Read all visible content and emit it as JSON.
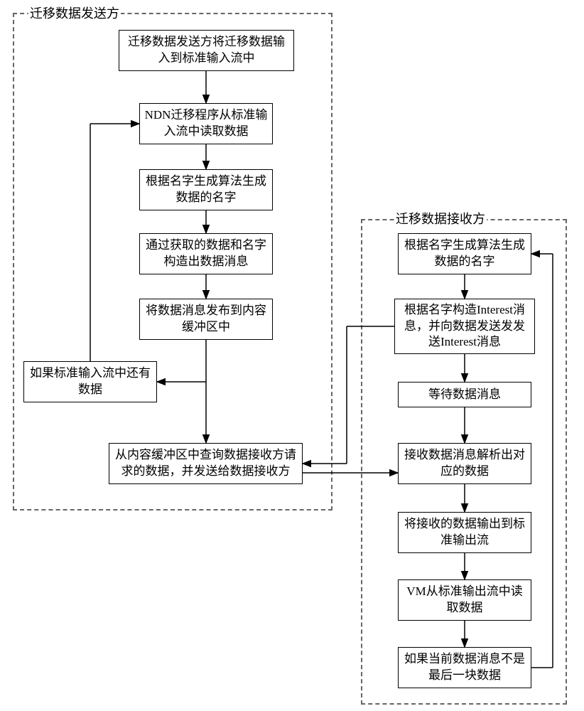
{
  "sender": {
    "title": "迁移数据发送方",
    "steps": {
      "b1": "迁移数据发送方将迁移数据输入到标准输入流中",
      "b2": "NDN迁移程序从标准输入流中读取数据",
      "b3": "根据名字生成算法生成数据的名字",
      "b4": "通过获取的数据和名字构造出数据消息",
      "b5": "将数据消息发布到内容缓冲区中",
      "b6": "如果标准输入流中还有数据",
      "b7": "从内容缓冲区中查询数据接收方请求的数据，并发送给数据接收方"
    }
  },
  "receiver": {
    "title": "迁移数据接收方",
    "steps": {
      "r1": "根据名字生成算法生成数据的名字",
      "r2": "根据名字构造Interest消息，并向数据发送发发送Interest消息",
      "r3": "等待数据消息",
      "r4": "接收数据消息解析出对应的数据",
      "r5": "将接收的数据输出到标准输出流",
      "r6": "VM从标准输出流中读取数据",
      "r7": "如果当前数据消息不是最后一块数据"
    }
  },
  "chart_data": {
    "type": "flowchart",
    "swimlanes": [
      {
        "id": "sender",
        "title": "迁移数据发送方"
      },
      {
        "id": "receiver",
        "title": "迁移数据接收方"
      }
    ],
    "nodes": [
      {
        "id": "b1",
        "lane": "sender",
        "text": "迁移数据发送方将迁移数据输入到标准输入流中"
      },
      {
        "id": "b2",
        "lane": "sender",
        "text": "NDN迁移程序从标准输入流中读取数据"
      },
      {
        "id": "b3",
        "lane": "sender",
        "text": "根据名字生成算法生成数据的名字"
      },
      {
        "id": "b4",
        "lane": "sender",
        "text": "通过获取的数据和名字构造出数据消息"
      },
      {
        "id": "b5",
        "lane": "sender",
        "text": "将数据消息发布到内容缓冲区中"
      },
      {
        "id": "b6",
        "lane": "sender",
        "text": "如果标准输入流中还有数据"
      },
      {
        "id": "b7",
        "lane": "sender",
        "text": "从内容缓冲区中查询数据接收方请求的数据，并发送给数据接收方"
      },
      {
        "id": "r1",
        "lane": "receiver",
        "text": "根据名字生成算法生成数据的名字"
      },
      {
        "id": "r2",
        "lane": "receiver",
        "text": "根据名字构造Interest消息，并向数据发送发发送Interest消息"
      },
      {
        "id": "r3",
        "lane": "receiver",
        "text": "等待数据消息"
      },
      {
        "id": "r4",
        "lane": "receiver",
        "text": "接收数据消息解析出对应的数据"
      },
      {
        "id": "r5",
        "lane": "receiver",
        "text": "将接收的数据输出到标准输出流"
      },
      {
        "id": "r6",
        "lane": "receiver",
        "text": "VM从标准输出流中读取数据"
      },
      {
        "id": "r7",
        "lane": "receiver",
        "text": "如果当前数据消息不是最后一块数据"
      }
    ],
    "edges": [
      {
        "from": "b1",
        "to": "b2"
      },
      {
        "from": "b2",
        "to": "b3"
      },
      {
        "from": "b3",
        "to": "b4"
      },
      {
        "from": "b4",
        "to": "b5"
      },
      {
        "from": "b5",
        "to": "b6",
        "condition": "loop"
      },
      {
        "from": "b6",
        "to": "b2"
      },
      {
        "from": "b5",
        "to": "b7"
      },
      {
        "from": "r1",
        "to": "r2"
      },
      {
        "from": "r2",
        "to": "r3"
      },
      {
        "from": "r3",
        "to": "r4"
      },
      {
        "from": "r4",
        "to": "r5"
      },
      {
        "from": "r5",
        "to": "r6"
      },
      {
        "from": "r6",
        "to": "r7"
      },
      {
        "from": "r7",
        "to": "r1",
        "condition": "loop"
      },
      {
        "from": "r2",
        "to": "b7",
        "type": "cross"
      },
      {
        "from": "b7",
        "to": "r4",
        "type": "cross"
      }
    ]
  }
}
